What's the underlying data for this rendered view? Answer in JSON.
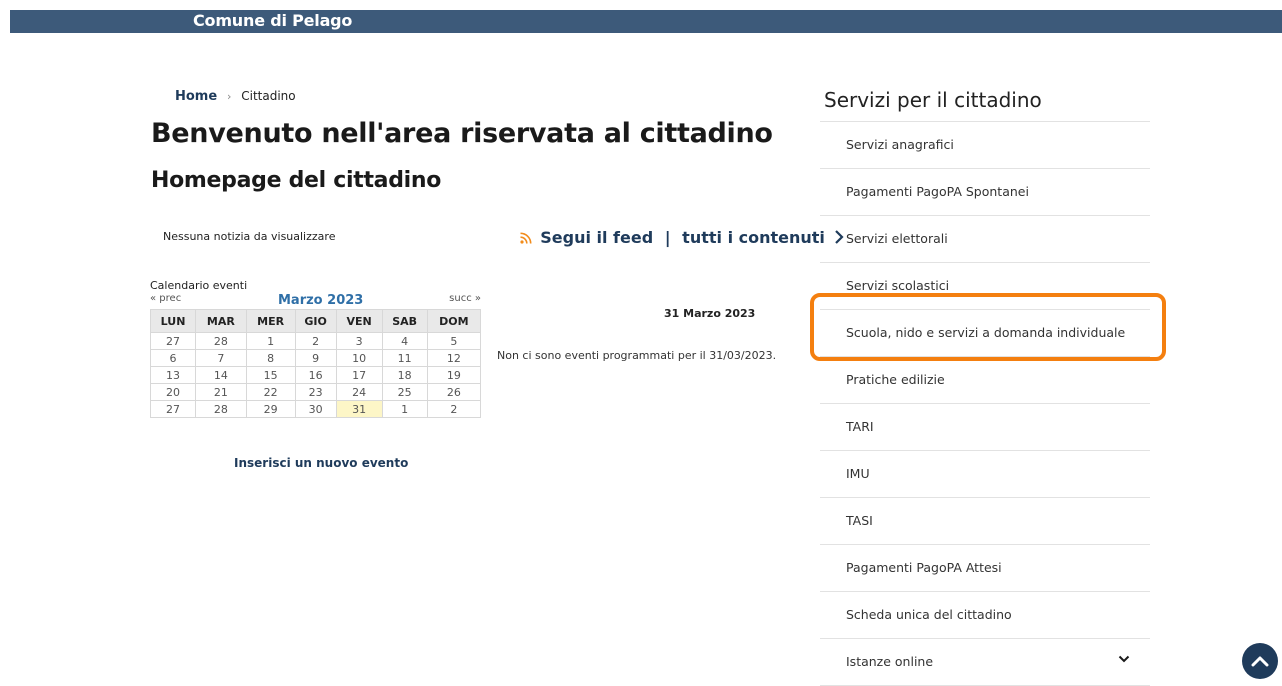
{
  "header": {
    "site_name": "Comune di Pelago"
  },
  "breadcrumb": {
    "home": "Home",
    "separator": "›",
    "current": "Cittadino"
  },
  "main": {
    "title": "Benvenuto nell'area riservata al cittadino",
    "subtitle": "Homepage del cittadino",
    "news_empty": "Nessuna notizia da visualizzare",
    "feed_label": "Segui il feed",
    "feed_separator": "|",
    "all_contents_label": "tutti i contenuti"
  },
  "calendar": {
    "title": "Calendario eventi",
    "prev_label": "« prec",
    "next_label": "succ »",
    "month_label": "Marzo 2023",
    "weekdays": [
      "LUN",
      "MAR",
      "MER",
      "GIO",
      "VEN",
      "SAB",
      "DOM"
    ],
    "weeks": [
      [
        "27",
        "28",
        "1",
        "2",
        "3",
        "4",
        "5"
      ],
      [
        "6",
        "7",
        "8",
        "9",
        "10",
        "11",
        "12"
      ],
      [
        "13",
        "14",
        "15",
        "16",
        "17",
        "18",
        "19"
      ],
      [
        "20",
        "21",
        "22",
        "23",
        "24",
        "25",
        "26"
      ],
      [
        "27",
        "28",
        "29",
        "30",
        "31",
        "1",
        "2"
      ]
    ],
    "today": "31",
    "new_event_label": "Inserisci un nuovo evento"
  },
  "events": {
    "day_heading": "31 Marzo 2023",
    "no_events": "Non ci sono eventi programmati per il 31/03/2023."
  },
  "sidebar": {
    "title": "Servizi per il cittadino",
    "highlighted_item": "Scuola, nido e servizi a domanda individuale",
    "highlight_color": "#f47f0f",
    "items": [
      {
        "label": "Servizi anagrafici"
      },
      {
        "label": "Pagamenti PagoPA Spontanei"
      },
      {
        "label": "Servizi elettorali"
      },
      {
        "label": "Servizi scolastici"
      },
      {
        "label": "Scuola, nido e servizi a domanda individuale"
      },
      {
        "label": "Pratiche edilizie"
      },
      {
        "label": "TARI"
      },
      {
        "label": "IMU"
      },
      {
        "label": "TASI"
      },
      {
        "label": "Pagamenti PagoPA Attesi"
      },
      {
        "label": "Scheda unica del cittadino"
      },
      {
        "label": "Istanze online"
      }
    ]
  },
  "icons": {
    "feed": "rss-icon",
    "more": "chevron-right-icon",
    "expand": "chevron-down-icon",
    "back_to_top": "chevron-up-icon"
  },
  "colors": {
    "header_bg": "#3d5a7a",
    "primary": "#1f3b5b",
    "month": "#2f6fa7",
    "rss": "#f28c1c",
    "today_bg": "#fdf6c7"
  }
}
